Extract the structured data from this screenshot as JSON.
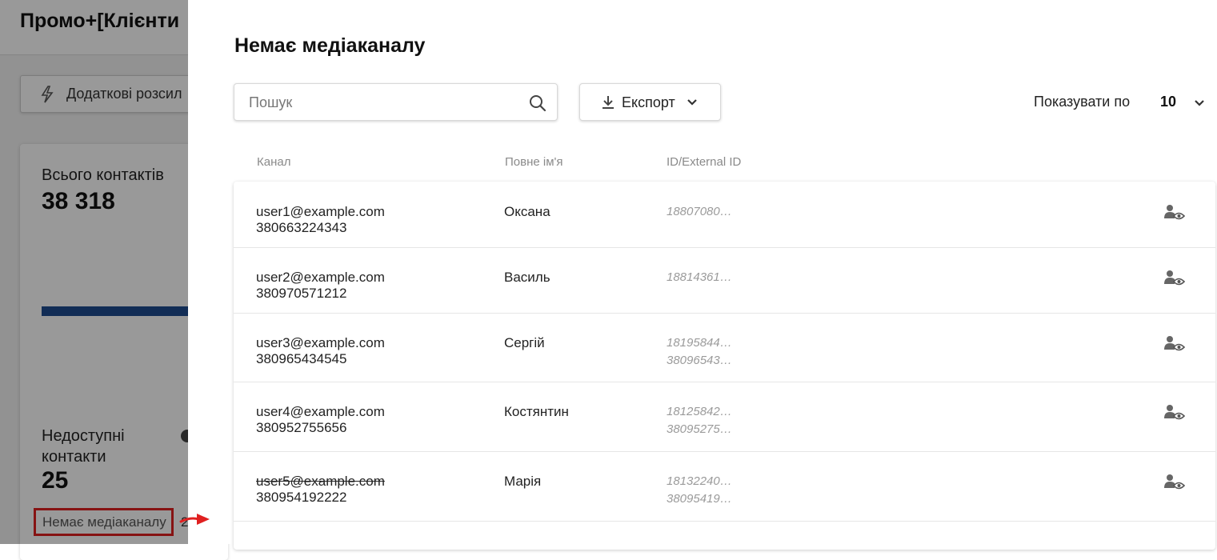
{
  "background": {
    "title": "Промо+[Клієнти",
    "extra_button_label": "Додаткові розсил",
    "total_contacts_label": "Всього контактів",
    "total_contacts_value": "38 318",
    "unavailable_label": "Недоступні контакти",
    "unavailable_value": "25",
    "no_channel_link": "Немає медіаканалу",
    "no_channel_count": "2"
  },
  "drawer": {
    "title": "Немає медіаканалу",
    "search": {
      "placeholder": "Пошук",
      "value": ""
    },
    "export_label": "Експорт",
    "page_size_label": "Показувати по",
    "page_size_value": "10"
  },
  "table": {
    "columns": [
      "Канал",
      "Повне ім'я",
      "ID/External ID"
    ],
    "rows": [
      {
        "email": "user1@example.com",
        "phone": "380663224343",
        "name": "Оксана",
        "ids": [
          "18807080…"
        ],
        "email_struck": false
      },
      {
        "email": "user2@example.com",
        "phone": "380970571212",
        "name": "Василь",
        "ids": [
          "18814361…"
        ],
        "email_struck": false
      },
      {
        "email": "user3@example.com",
        "phone": "380965434545",
        "name": "Сергій",
        "ids": [
          "18195844…",
          "38096543…"
        ],
        "email_struck": false
      },
      {
        "email": "user4@example.com",
        "phone": "380952755656",
        "name": "Костянтин",
        "ids": [
          "18125842…",
          "38095275…"
        ],
        "email_struck": false
      },
      {
        "email": "user5@example.com",
        "phone": "380954192222",
        "name": "Марія",
        "ids": [
          "18132240…",
          "38095419…"
        ],
        "email_struck": true
      }
    ]
  },
  "icons": {
    "search": "search-icon",
    "export": "download-icon",
    "dropdown": "chevron-down-icon",
    "row_action": "view-contact-icon",
    "annotation": "red-arrow-icon"
  },
  "colors": {
    "highlight_border": "#e02020",
    "progress_bar": "#1f4b8f"
  }
}
